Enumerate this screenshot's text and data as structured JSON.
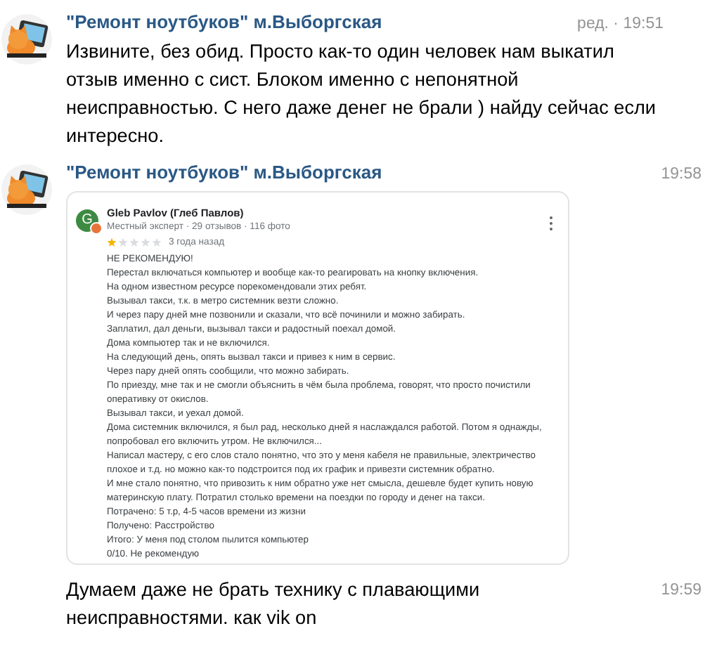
{
  "messages": [
    {
      "kind": "text",
      "author": "\"Ремонт ноутбуков\" м.Выборгская",
      "time": "ред. · 19:51",
      "text": "Извините, без обид. Просто как-то один человек нам выкатил отзыв именно с сист. Блоком именно с непонятной неисправностью. С него даже денег не брали ) найду сейчас если интересно."
    },
    {
      "kind": "review",
      "author": "\"Ремонт ноутбуков\" м.Выборгская",
      "time": "19:58",
      "review": {
        "initial": "G",
        "name": "Gleb Pavlov (Глеб Павлов)",
        "meta": "Местный эксперт · 29 отзывов · 116 фото",
        "stars": 1,
        "age": "3 года назад",
        "lines": [
          "НЕ РЕКОМЕНДУЮ!",
          "Перестал включаться компьютер и вообще как-то реагировать на кнопку включения.",
          "На одном известном ресурсе порекомендовали этих ребят.",
          "Вызывал такси, т.к. в метро системник везти сложно.",
          "И через пару дней мне позвонили и сказали, что всё починили и можно забирать.",
          "Заплатил, дал деньги, вызывал такси и радостный поехал домой.",
          "Дома компьютер так и не включился.",
          "На следующий день, опять вызвал такси и привез к ним в сервис.",
          "Через пару дней опять сообщили, что можно забирать.",
          "По приезду, мне так и не смогли объяснить в чём была проблема, говорят, что просто почистили",
          "оперативку от окислов.",
          "Вызывал такси, и уехал домой.",
          "Дома системник включился, я был рад, несколько дней я наслаждался работой. Потом я однажды,",
          "попробовал его включить утром. Не включился...",
          "Написал мастеру, с его слов стало понятно, что это у меня кабеля не правильные, электричество",
          "плохое и т.д. но можно как-то подстроится под их график и привезти системник обратно.",
          "И мне стало понятно, что привозить к ним обратно уже нет смысла, дешевле будет купить новую",
          "материнскую плату. Потратил столько времени на поездки по городу и денег на такси.",
          "Потрачено: 5 т.р, 4-5 часов времени из жизни",
          "Получено: Расстройство",
          "Итого: У меня под столом пылится компьютер",
          "0/10. Не рекомендую"
        ]
      }
    },
    {
      "kind": "continuation",
      "time": "19:59",
      "text": "Думаем даже не брать технику с плавающими неисправностями. как vik on"
    }
  ]
}
